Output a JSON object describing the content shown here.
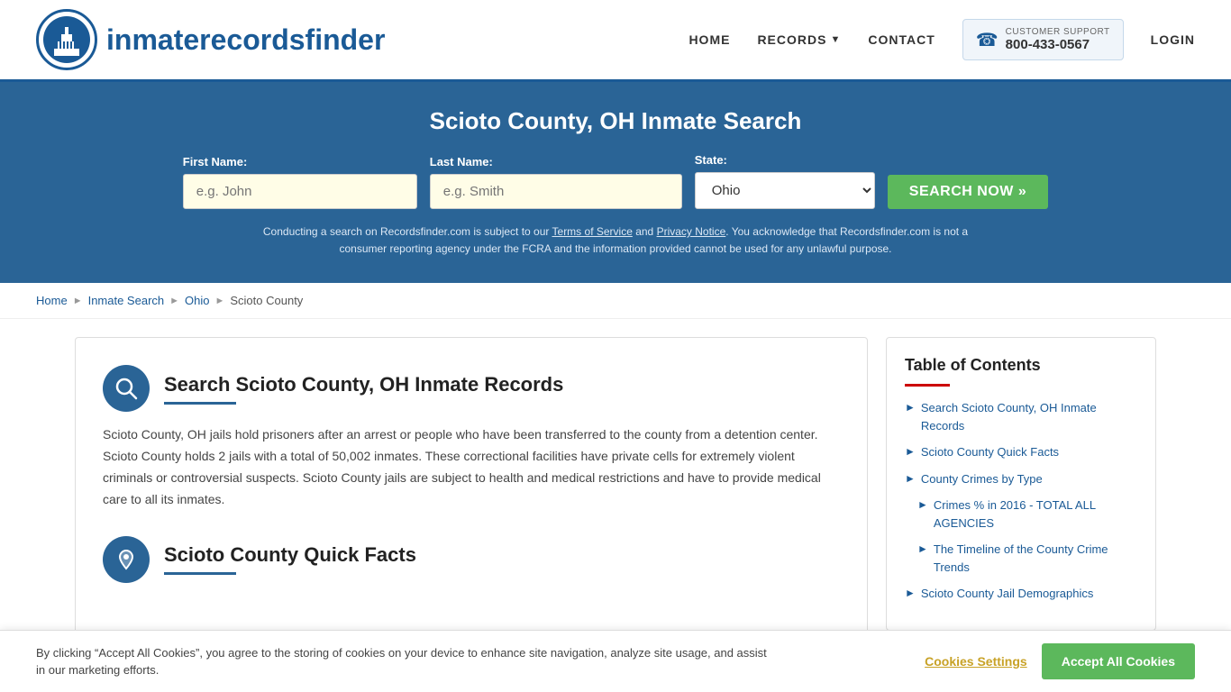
{
  "header": {
    "logo_text_light": "inmaterecords",
    "logo_text_bold": "finder",
    "nav": {
      "home": "HOME",
      "records": "RECORDS",
      "contact": "CONTACT",
      "login": "LOGIN"
    },
    "support": {
      "label": "CUSTOMER SUPPORT",
      "number": "800-433-0567"
    }
  },
  "hero": {
    "title": "Scioto County, OH Inmate Search",
    "first_name_label": "First Name:",
    "first_name_placeholder": "e.g. John",
    "last_name_label": "Last Name:",
    "last_name_placeholder": "e.g. Smith",
    "state_label": "State:",
    "state_value": "Ohio",
    "search_button": "SEARCH NOW »",
    "disclaimer": "Conducting a search on Recordsfinder.com is subject to our Terms of Service and Privacy Notice. You acknowledge that Recordsfinder.com is not a consumer reporting agency under the FCRA and the information provided cannot be used for any unlawful purpose."
  },
  "breadcrumb": {
    "home": "Home",
    "inmate_search": "Inmate Search",
    "ohio": "Ohio",
    "current": "Scioto County"
  },
  "article": {
    "section1": {
      "title": "Search Scioto County, OH Inmate Records",
      "body": "Scioto County, OH jails hold prisoners after an arrest or people who have been transferred to the county from a detention center. Scioto County holds 2 jails with a total of 50,002 inmates. These correctional facilities have private cells for extremely violent criminals or controversial suspects. Scioto County jails are subject to health and medical restrictions and have to provide medical care to all its inmates."
    },
    "section2": {
      "title": "Scioto County Quick Facts"
    }
  },
  "toc": {
    "title": "Table of Contents",
    "items": [
      {
        "label": "Search Scioto County, OH Inmate Records",
        "sub": false
      },
      {
        "label": "Scioto County Quick Facts",
        "sub": false
      },
      {
        "label": "County Crimes by Type",
        "sub": false
      },
      {
        "label": "Crimes % in 2016 - TOTAL ALL AGENCIES",
        "sub": true
      },
      {
        "label": "The Timeline of the County Crime Trends",
        "sub": true
      },
      {
        "label": "Scioto County Jail Demographics",
        "sub": false
      }
    ]
  },
  "cookie": {
    "text": "By clicking “Accept All Cookies”, you agree to the storing of cookies on your device to enhance site navigation, analyze site usage, and assist in our marketing efforts.",
    "settings_btn": "Cookies Settings",
    "accept_btn": "Accept All Cookies"
  }
}
